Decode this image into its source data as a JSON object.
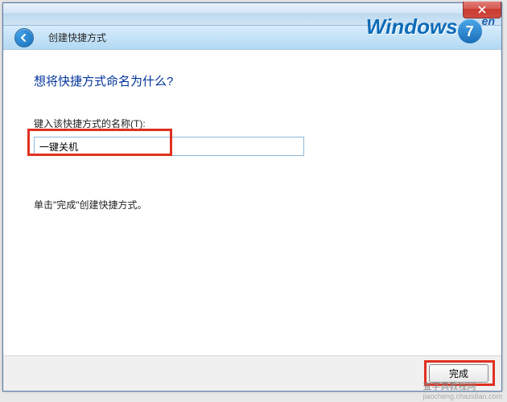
{
  "titlebar": {
    "close": "×"
  },
  "header": {
    "title": "创建快捷方式"
  },
  "watermark": {
    "brand": "Windows",
    "seven": "7",
    "en": "en"
  },
  "content": {
    "question": "想将快捷方式命名为什么?",
    "input_label": "键入该快捷方式的名称(T):",
    "input_value": "一键关机",
    "instruction": "单击\"完成\"创建快捷方式。"
  },
  "footer": {
    "finish": "完成"
  },
  "credit": {
    "line1": "查字典教程网",
    "line2": "jiaocheng.chazidian.com"
  }
}
